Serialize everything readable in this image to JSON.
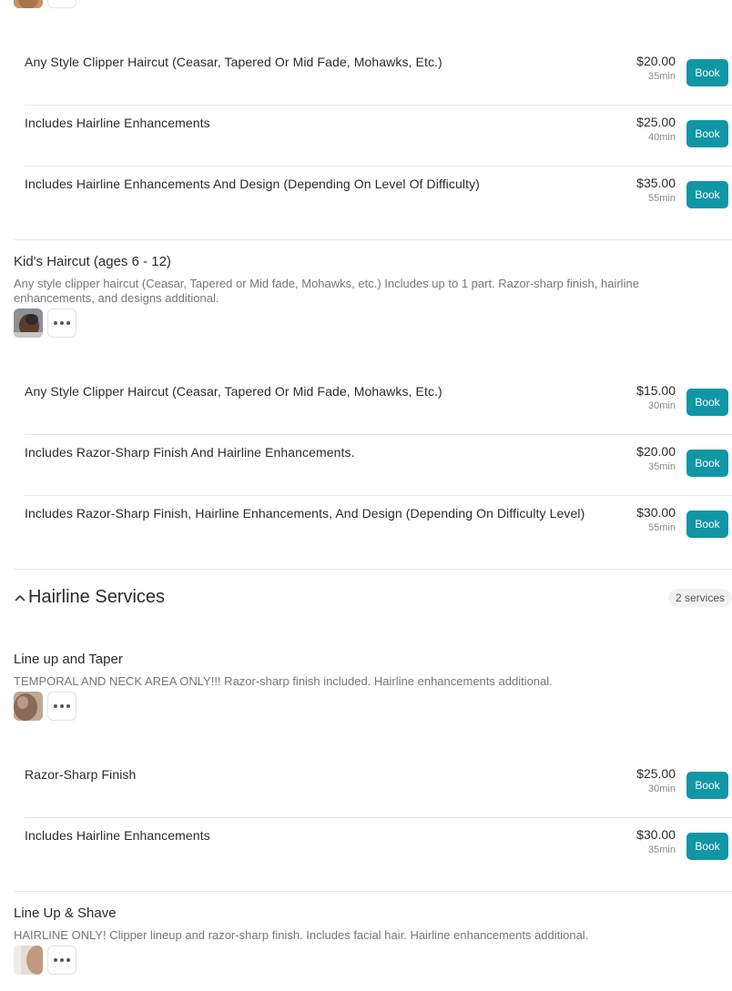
{
  "colors": {
    "accent": "#1196a6",
    "text": "#2b2b2b",
    "muted": "#8a8a8a"
  },
  "book_label": "Book",
  "top_group": {
    "services": [
      {
        "name": "Any Style Clipper Haircut (Ceasar, Tapered Or Mid Fade, Mohawks, Etc.)",
        "price": "$20.00",
        "duration": "35min"
      },
      {
        "name": "Includes Hairline Enhancements",
        "price": "$25.00",
        "duration": "40min"
      },
      {
        "name": "Includes Hairline Enhancements And Design (Depending On Level Of Difficulty)",
        "price": "$35.00",
        "duration": "55min"
      }
    ]
  },
  "kids_group": {
    "title": "Kid's Haircut (ages 6 - 12)",
    "description": "Any style clipper haircut (Ceasar, Tapered or Mid fade, Mohawks, etc.) Includes up to 1 part. Razor-sharp finish, hairline enhancements, and designs additional.",
    "services": [
      {
        "name": "Any Style Clipper Haircut (Ceasar, Tapered Or Mid Fade, Mohawks, Etc.)",
        "price": "$15.00",
        "duration": "30min"
      },
      {
        "name": "Includes Razor-Sharp Finish And Hairline Enhancements.",
        "price": "$20.00",
        "duration": "35min"
      },
      {
        "name": "Includes Razor-Sharp Finish, Hairline Enhancements, And Design (Depending On Difficulty Level)",
        "price": "$30.00",
        "duration": "55min"
      }
    ]
  },
  "category": {
    "title": "Hairline Services",
    "count": "2 services",
    "icon": "chevron-up-icon"
  },
  "lineup_taper": {
    "title": "Line up and Taper",
    "description": "TEMPORAL AND NECK AREA ONLY!!! Razor-sharp finish included. Hairline enhancements additional.",
    "services": [
      {
        "name": "Razor-Sharp Finish",
        "price": "$25.00",
        "duration": "30min"
      },
      {
        "name": "Includes Hairline Enhancements",
        "price": "$30.00",
        "duration": "35min"
      }
    ]
  },
  "lineup_shave": {
    "title": "Line Up & Shave",
    "description": "HAIRLINE ONLY! Clipper lineup and razor-sharp finish. Includes facial hair. Hairline enhancements additional."
  }
}
